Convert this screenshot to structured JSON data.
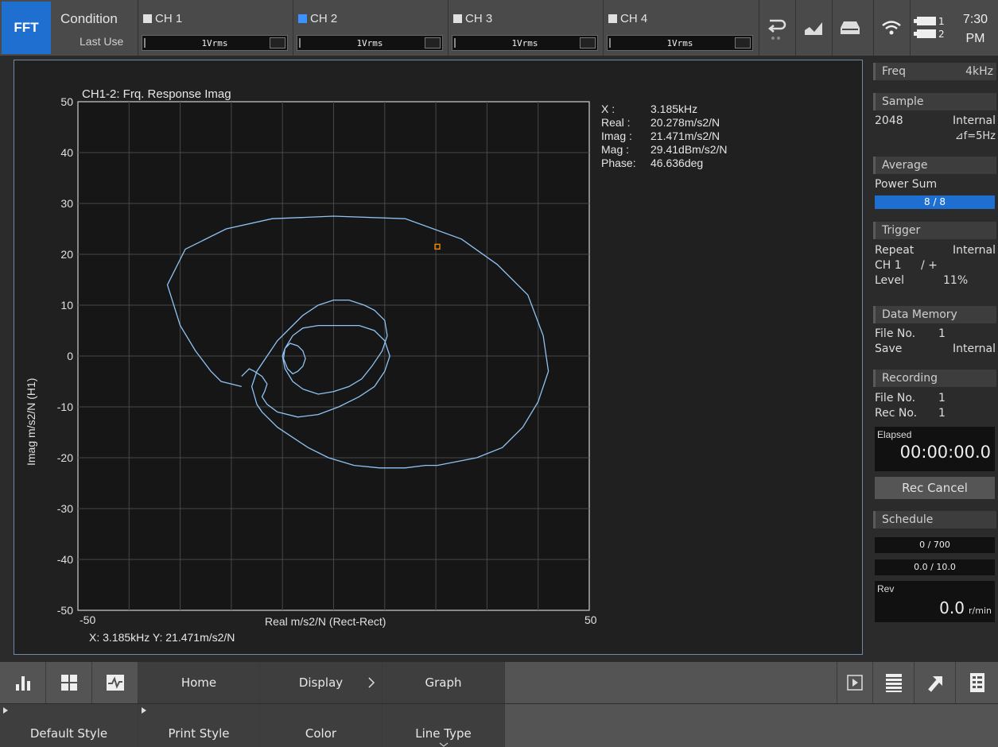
{
  "topbar": {
    "mode": "FFT",
    "condition": "Condition",
    "last_use": "Last Use",
    "channels": [
      {
        "name": "CH 1",
        "range": "1Vrms",
        "color": "#e0e0e0"
      },
      {
        "name": "CH 2",
        "range": "1Vrms",
        "color": "#3b93ff"
      },
      {
        "name": "CH 3",
        "range": "1Vrms",
        "color": "#e0e0e0"
      },
      {
        "name": "CH 4",
        "range": "1Vrms",
        "color": "#e0e0e0"
      }
    ],
    "icons": [
      "return-icon",
      "chart-marker-icon",
      "storage-icon",
      "wifi-icon",
      "battery-icon"
    ],
    "battery_labels": [
      "1",
      "2"
    ],
    "time": "7:30",
    "ampm": "PM"
  },
  "readout": {
    "x_label": "X  :",
    "x_value": "3.185kHz",
    "real_label": "Real :",
    "real_value": "20.278m/s2/N",
    "imag_label": "Imag :",
    "imag_value": "21.471m/s2/N",
    "mag_label": "Mag  :",
    "mag_value": "29.41dBm/s2/N",
    "phase_label": "Phase:",
    "phase_value": "46.636deg"
  },
  "cursor_text": "X: 3.185kHz Y: 21.471m/s2/N",
  "chart_data": {
    "type": "line",
    "title": "CH1-2: Frq. Response Imag",
    "xlabel": "Real m/s2/N (Rect-Rect)",
    "ylabel": "Imag m/s2/N (H1)",
    "xlim": [
      -50,
      50
    ],
    "ylim": [
      -50,
      50
    ],
    "x_tick_labels": [
      "-50",
      "50"
    ],
    "y_ticks": [
      50,
      40,
      30,
      20,
      10,
      0,
      -10,
      -20,
      -30,
      -40,
      -50
    ],
    "grid": true,
    "line_color": "#8fc3f5",
    "marker_color": "#ff8c00",
    "marker": {
      "x": 20.3,
      "y": 21.5
    },
    "series": [
      {
        "x": [
          -18,
          -17,
          -16.5,
          -15.5,
          -14,
          -13,
          -13.5,
          -14,
          -13,
          -11,
          -7,
          -3,
          1,
          5,
          8,
          10,
          11,
          10,
          8,
          5,
          1,
          -3,
          -6,
          -8,
          -9.5,
          -9.8,
          -9,
          -8,
          -7,
          -6,
          -5.5,
          -6,
          -7,
          -8.5,
          -9.5,
          -10,
          -9.5,
          -8,
          -6,
          -3,
          0,
          3,
          5.5,
          7.5,
          9.5,
          10.5,
          10,
          8,
          6,
          3,
          0,
          -3,
          -6,
          -9,
          -11,
          -13,
          -15,
          -16,
          -15,
          -14,
          -13,
          -11,
          -8,
          -5,
          -1,
          4,
          9,
          14,
          18,
          20.3,
          28,
          33,
          37,
          40,
          42,
          41,
          38,
          32,
          25,
          14,
          0,
          -12,
          -21,
          -29,
          -32.5,
          -30,
          -27,
          -24,
          -22,
          -18
        ],
        "y": [
          -4,
          -3,
          -2.5,
          -3,
          -4,
          -5.5,
          -7,
          -8,
          -9.5,
          -11,
          -12,
          -11.5,
          -10,
          -8,
          -6,
          -3,
          0,
          3,
          5,
          6,
          6,
          6,
          5.5,
          4,
          1.5,
          -0.5,
          -2.5,
          -3.5,
          -3,
          -2,
          -0.5,
          1,
          2,
          2.5,
          1.5,
          0,
          -2.5,
          -5,
          -6.5,
          -7.5,
          -7,
          -6,
          -4.5,
          -2,
          1,
          4,
          7,
          9,
          10,
          11,
          11,
          10,
          8,
          5,
          3,
          0,
          -3,
          -6,
          -9.5,
          -11,
          -12,
          -14,
          -16,
          -18,
          -20,
          -21.5,
          -22,
          -22,
          -21.5,
          -21.5,
          -20,
          -18,
          -14,
          -9,
          -3,
          4,
          12,
          18,
          23,
          27,
          27.5,
          27,
          25,
          21,
          14,
          6,
          1,
          -3,
          -5,
          -6
        ]
      }
    ]
  },
  "rpanel": {
    "freq_label": "Freq",
    "freq_value": "4kHz",
    "sample_label": "Sample",
    "sample_value": "2048",
    "sample_source": "Internal",
    "delta_f": "⊿f=5Hz",
    "average_label": "Average",
    "average_mode": "Power Sum",
    "average_progress": "8 / 8",
    "trigger_label": "Trigger",
    "trigger_mode": "Repeat",
    "trigger_source": "Internal",
    "trigger_ch": "CH 1",
    "trigger_slope": "/ +",
    "trigger_level_label": "Level",
    "trigger_level": "11%",
    "datamem_label": "Data Memory",
    "file_no_label": "File No.",
    "file_no": "1",
    "save_label": "Save",
    "save_value": "Internal",
    "recording_label": "Recording",
    "rec_file_label": "File No.",
    "rec_file": "1",
    "rec_no_label": "Rec No.",
    "rec_no": "1",
    "elapsed_label": "Elapsed",
    "elapsed_value": "00:00:00.0",
    "rec_cancel": "Rec Cancel",
    "schedule_label": "Schedule",
    "schedule_a": "0 / 700",
    "schedule_b": "0.0 / 10.0",
    "rev_label": "Rev",
    "rev_value": "0.0",
    "rev_unit": "r/min"
  },
  "bottombar": {
    "home": "Home",
    "display": "Display",
    "graph": "Graph",
    "default_style": "Default Style",
    "print_style": "Print Style",
    "color": "Color",
    "line_type": "Line Type"
  }
}
